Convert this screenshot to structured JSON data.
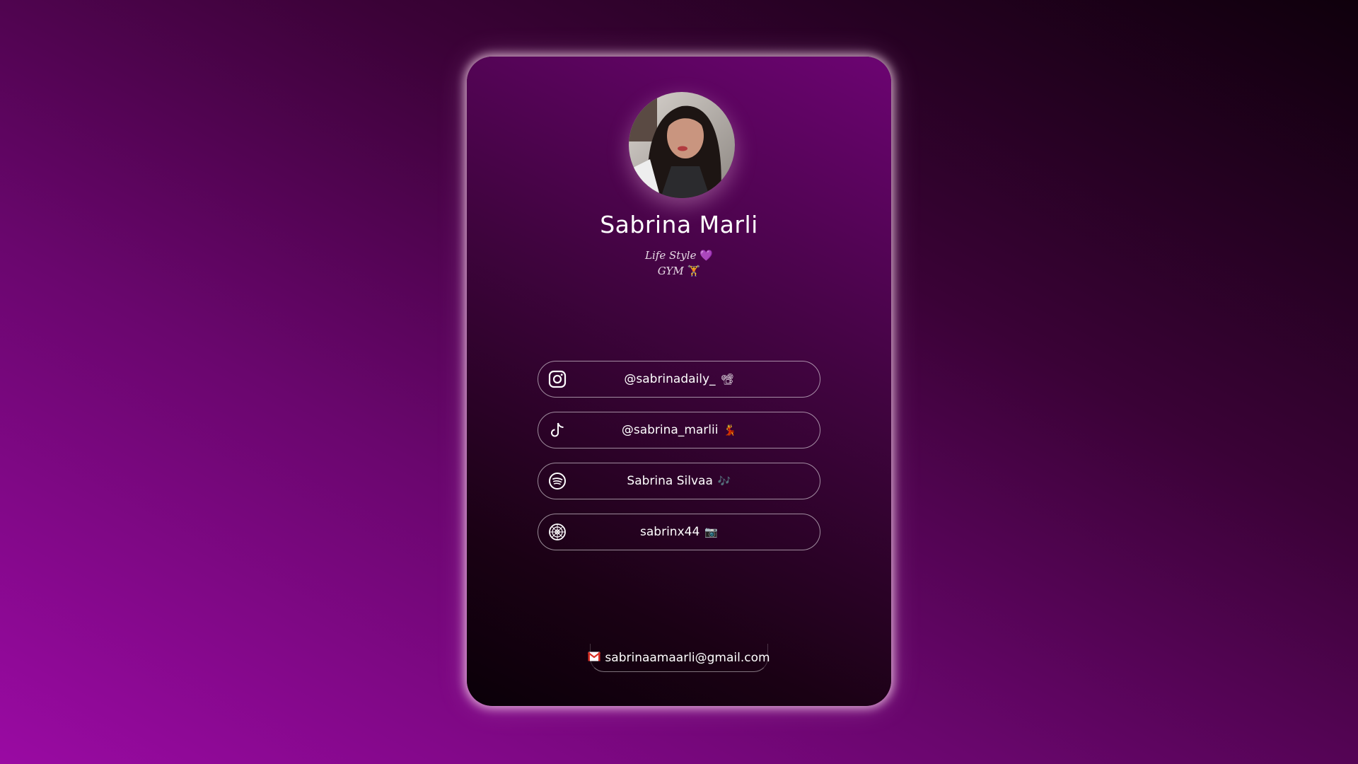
{
  "profile": {
    "name": "Sabrina Marli",
    "bio_line1": "Life Style",
    "bio_line1_emoji": "💜",
    "bio_line2": "GYM",
    "bio_line2_emoji": "🏋"
  },
  "links": [
    {
      "icon": "instagram-icon",
      "label": "@sabrinadaily_",
      "emoji": "📽"
    },
    {
      "icon": "tiktok-icon",
      "label": "@sabrina_marlii",
      "emoji": "💃"
    },
    {
      "icon": "spotify-icon",
      "label": "Sabrina Silvaa",
      "emoji": "🎶"
    },
    {
      "icon": "vsco-icon",
      "label": "sabrinx44",
      "emoji": "📷"
    }
  ],
  "contact": {
    "email": "sabrinaamaarli@gmail.com"
  },
  "colors": {
    "background_start": "#9a0aa3",
    "background_end": "#0f000c",
    "card_glow": "#ffdcf0",
    "text": "#ffffff"
  }
}
